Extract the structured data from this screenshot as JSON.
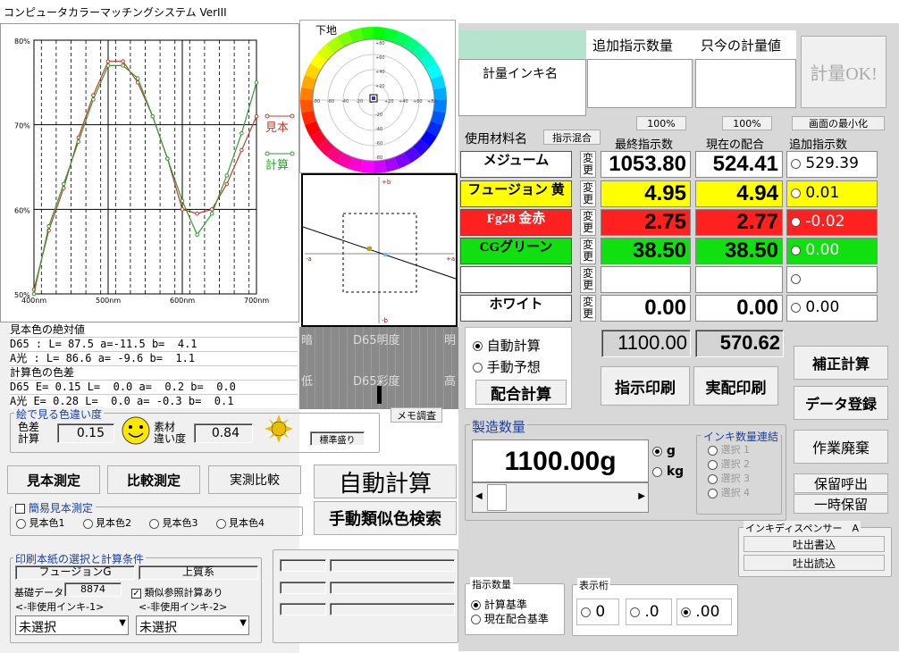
{
  "window": {
    "title": "コンピュータカラーマッチングシステム VerIII"
  },
  "chart_data": {
    "type": "line",
    "x_ticks": [
      "400nm",
      "500nm",
      "600nm",
      "700nm"
    ],
    "y_ticks": [
      "80%",
      "70%",
      "60%",
      "50%"
    ],
    "x": [
      400,
      420,
      440,
      460,
      480,
      500,
      520,
      540,
      560,
      580,
      600,
      620,
      640,
      660,
      680,
      700
    ],
    "xlim": [
      400,
      700
    ],
    "ylim": [
      50,
      80
    ],
    "series": [
      {
        "name": "見本",
        "color": "#c0392b",
        "values": [
          50.5,
          57.5,
          62.5,
          68.5,
          73.5,
          77.5,
          77.5,
          75,
          71,
          66,
          60,
          59.5,
          60,
          63,
          67,
          71
        ]
      },
      {
        "name": "計算",
        "color": "#2e9e2e",
        "values": [
          50,
          58,
          63,
          68,
          73,
          77,
          77,
          75.5,
          71,
          66,
          61,
          57,
          59.5,
          64,
          69,
          75
        ]
      }
    ],
    "grid": true
  },
  "wheel": {
    "label": "下地",
    "ticks_h": [
      "-80",
      "-60",
      "-40",
      "-20",
      "0",
      "+20",
      "+40",
      "+60",
      "+80"
    ],
    "ticks_v": [
      "+80",
      "+60",
      "+40",
      "+20",
      "0",
      "-20",
      "-40",
      "-60",
      "-80"
    ]
  },
  "abplot": {
    "top": "+b",
    "bottom": "-b",
    "left": "-a",
    "right": "+a"
  },
  "bars": {
    "brightness": {
      "left": "暗",
      "center": "D65明度",
      "right": "明"
    },
    "chroma": {
      "left": "低",
      "center": "D65彩度",
      "right": "高"
    }
  },
  "info": {
    "abs_title": "見本色の絶対値",
    "abs_d65": "D65 : L= 87.5 a=-11.5 b=  4.1",
    "abs_a": "A光 : L= 86.6 a= -9.6 b=  1.1",
    "diff_title": "計算色の色差",
    "diff_d65": "D65 E= 0.15 L=  0.0 a=  0.2 b=  0.0",
    "diff_a": "A光 E= 0.28 L=  0.0 a= -0.3 b=  0.1"
  },
  "visual": {
    "group": "絵で見る色違い度",
    "label_de": "色差\n計算",
    "de": "0.15",
    "label_sozai": "素材\n違い度",
    "sozai": "0.84",
    "memo": "メモ調査",
    "std": "標準盛り"
  },
  "left_buttons": {
    "sample": "見本測定",
    "compare": "比較測定",
    "actual": "実測比較",
    "auto": "自動計算",
    "manual": "手動類似色検索"
  },
  "simple": {
    "title": "簡易見本測定",
    "options": [
      "見本色1",
      "見本色2",
      "見本色3",
      "見本色4"
    ]
  },
  "paper": {
    "title": "印刷本紙の選択と計算条件",
    "field1": "フュージョンG",
    "field2": "上質系",
    "base_label": "基礎データ",
    "base_value": "8874",
    "similar": "類似参照計算あり",
    "unused1": "<-非使用インキ-1>",
    "unused2": "<-非使用インキ-2>",
    "select1": "未選択",
    "select2": "未選択"
  },
  "header": {
    "add_qty": "追加指示数量",
    "cur_meas": "只今の計量値",
    "ink_name": "計量インキ名",
    "meas_ok": "計量OK!"
  },
  "table": {
    "material_label": "使用材料名",
    "mix_btn": "指示混合",
    "pct1": "100%",
    "pct2": "100%",
    "minimize": "画面の最小化",
    "col_final": "最終指示数",
    "col_current": "現在の配合",
    "col_add": "追加指示数",
    "henkou": "変更",
    "rows": [
      {
        "name": "メジューム",
        "final": "1053.80",
        "current": "524.41",
        "add": "529.39",
        "color": "#ffffff",
        "addcolor": "#ffffff",
        "addtext": "#000000"
      },
      {
        "name": "フュージョン 黄",
        "final": "4.95",
        "current": "4.94",
        "add": "0.01",
        "color": "#ffff00",
        "addcolor": "#ffff00",
        "addtext": "#000000"
      },
      {
        "name": "Fg28 金赤",
        "final": "2.75",
        "current": "2.77",
        "add": "-0.02",
        "color": "#ff2020",
        "addcolor": "#ff2020",
        "addtext": "#ffffff"
      },
      {
        "name": "CGグリーン",
        "final": "38.50",
        "current": "38.50",
        "add": "0.00",
        "color": "#10e010",
        "addcolor": "#10e010",
        "addtext": "#ffffff"
      },
      {
        "name": "",
        "final": "",
        "current": "",
        "add": "",
        "color": "#ffffff",
        "addcolor": "#ffffff",
        "addtext": "#000000"
      },
      {
        "name": "ホワイト",
        "final": "0.00",
        "current": "0.00",
        "add": "0.00",
        "color": "#ffffff",
        "addcolor": "#ffffff",
        "addtext": "#000000"
      }
    ],
    "total_final": "1100.00",
    "total_current": "570.62"
  },
  "calc": {
    "auto": "自動計算",
    "manual": "手動予想",
    "mix": "配合計算",
    "print_inst": "指示印刷",
    "print_actual": "実配印刷"
  },
  "right_buttons": {
    "correct": "補正計算",
    "register": "データ登録",
    "discard": "作業廃棄",
    "recall": "保留呼出",
    "hold": "一時保留"
  },
  "production": {
    "title": "製造数量",
    "value": "1100.00g",
    "unit_g": "g",
    "unit_kg": "kg",
    "ink_link": "インキ数量連結",
    "choices": [
      "選択 1",
      "選択 2",
      "選択 3",
      "選択 4"
    ]
  },
  "dispenser": {
    "title": "インキディスペンサー　A",
    "write": "吐出書込",
    "read": "吐出読込"
  },
  "instr": {
    "title": "指示数量",
    "opt1": "計算基準",
    "opt2": "現在配合基準"
  },
  "digits": {
    "title": "表示桁",
    "opt0": "0",
    "opt1": ".0",
    "opt2": ".00"
  }
}
